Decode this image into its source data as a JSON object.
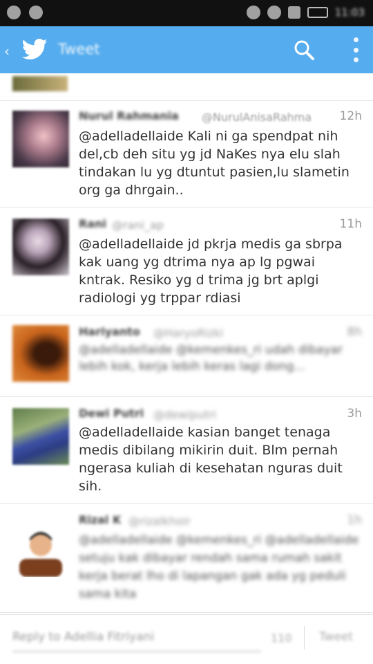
{
  "status_bar": {
    "clock": "11:03"
  },
  "action_bar": {
    "title": "Tweet",
    "colors": {
      "bar": "#55acee",
      "text": "#ffffff"
    }
  },
  "tweets": [
    {
      "name": "Nurul Rahmania",
      "handle": "@NurulAnisaRahma",
      "time": "12h",
      "text": "@adelladellaide Kali ni ga spendpat nih del,cb deh situ yg jd NaKes nya elu slah tindakan lu yg dtuntut pasien,lu slametin org ga dhrgain..",
      "avatar": "avatar-photo-pink"
    },
    {
      "name": "Rani",
      "handle": "@rani_ap",
      "time": "11h",
      "text": "@adelladellaide jd pkrja medis ga sbrpa kak uang yg dtrima nya ap lg pgwai kntrak. Resiko yg d trima jg brt aplgi radiologi yg trppar rdiasi",
      "avatar": "avatar-photo-dark-hair"
    },
    {
      "name": "Hariyanto",
      "handle": "@HaryoRizki",
      "time": "8h",
      "text": "@adelladellaide @kemenkes_ri udah dibayar lebih kok, kerja lebih keras lagi dong...",
      "avatar": "avatar-photo-orange"
    },
    {
      "name": "Dewi Putri",
      "handle": "@dewiputri",
      "time": "3h",
      "text": "@adelladellaide kasian banget tenaga medis dibilang mikirin duit. Blm pernah ngerasa kuliah di kesehatan nguras duit sih.",
      "avatar": "avatar-photo-green"
    },
    {
      "name": "Rizal K",
      "handle": "@rizalkhoir",
      "time": "1h",
      "text": "@adelladellaide @kemenkes_ri @adelladellaide setuju kak dibayar rendah sama rumah sakit kerja berat lho di lapangan gak ada yg peduli sama kita",
      "avatar": "avatar-illustration"
    }
  ],
  "reply_bar": {
    "placeholder": "Reply to Adellia Fitriyani",
    "count": "110",
    "button": "Tweet"
  }
}
